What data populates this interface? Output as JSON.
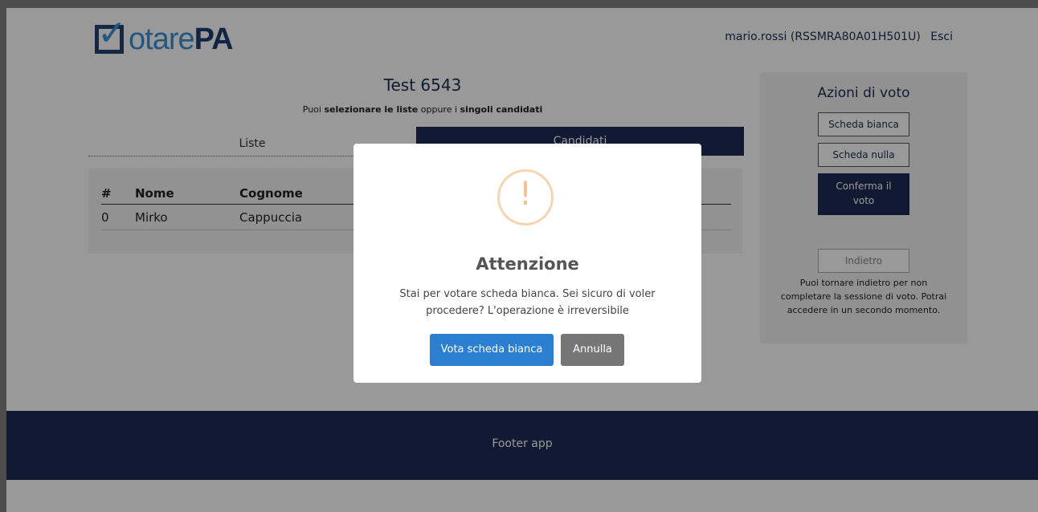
{
  "header": {
    "logo_left": "otare",
    "logo_right": "PA",
    "user": "mario.rossi (RSSMRA80A01H501U)",
    "logout": "Esci"
  },
  "main": {
    "title": "Test 6543",
    "subtitle_pre": "Puoi ",
    "subtitle_b1": "selezionare le liste",
    "subtitle_mid": " oppure i ",
    "subtitle_b2": "singoli candidati",
    "tabs": [
      {
        "label": "Liste",
        "active": false
      },
      {
        "label": "Candidati",
        "active": true
      }
    ],
    "table": {
      "headers": [
        "#",
        "Nome",
        "Cognome"
      ],
      "rows": [
        [
          "0",
          "Mirko",
          "Cappuccia"
        ]
      ]
    }
  },
  "actions": {
    "title": "Azioni di voto",
    "bianca": "Scheda bianca",
    "nulla": "Scheda nulla",
    "conferma_line1": "Conferma il",
    "conferma_line2": "voto",
    "indietro": "Indietro",
    "note": "Puoi tornare indietro per non completare la sessione di voto. Potrai accedere in un secondo momento."
  },
  "footer": {
    "text": "Footer app"
  },
  "modal": {
    "icon": "warning-icon",
    "icon_glyph": "!",
    "title": "Attenzione",
    "text": "Stai per votare scheda bianca. Sei sicuro di voler procedere? L'operazione è irreversibile",
    "confirm": "Vota scheda bianca",
    "cancel": "Annulla",
    "confirm_color": "#2c7ed0",
    "cancel_color": "#767676",
    "icon_color": "#f7c08f"
  }
}
